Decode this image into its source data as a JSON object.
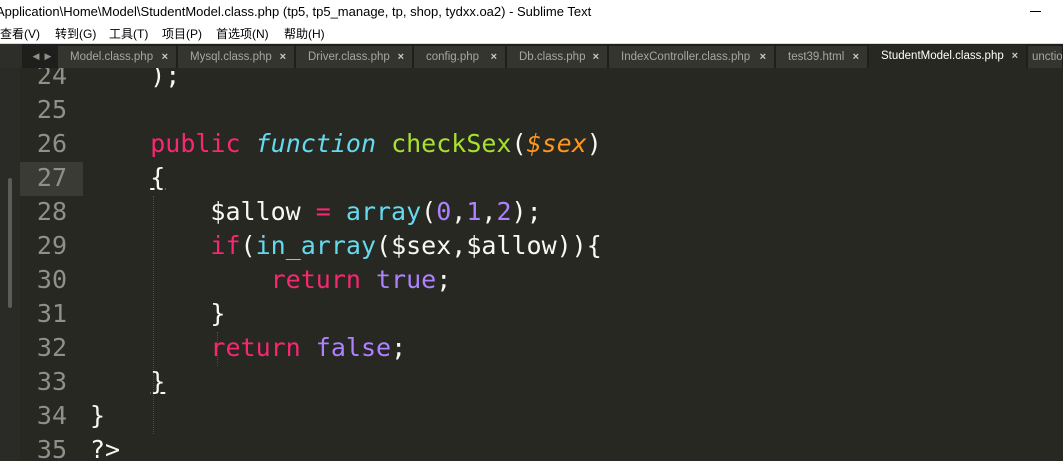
{
  "window": {
    "title": "Application\\Home\\Model\\StudentModel.class.php (tp5, tp5_manage, tp, shop, tydxx.oa2) - Sublime Text"
  },
  "menu": [
    "查看(V)",
    "转到(G)",
    "工具(T)",
    "项目(P)",
    "首选项(N)",
    "帮助(H)"
  ],
  "tabs": [
    {
      "label": "Model.class.php",
      "close": "×"
    },
    {
      "label": "Mysql.class.php",
      "close": "×"
    },
    {
      "label": "Driver.class.php",
      "close": "×"
    },
    {
      "label": "config.php",
      "close": "×"
    },
    {
      "label": "Db.class.php",
      "close": "×"
    },
    {
      "label": "IndexController.class.php",
      "close": "×"
    },
    {
      "label": "test39.html",
      "close": "×"
    },
    {
      "label": "StudentModel.class.php",
      "close": "×",
      "active": true
    },
    {
      "label": "unctio",
      "close": ""
    }
  ],
  "tab_arrows": {
    "left": "◀",
    "right": "▶"
  },
  "editor": {
    "current_line": "27",
    "lines": [
      {
        "num": "24",
        "parts": [
          {
            "t": "    );",
            "c": ""
          }
        ]
      },
      {
        "num": "25",
        "parts": []
      },
      {
        "num": "26",
        "parts": [
          {
            "t": "    ",
            "c": ""
          },
          {
            "t": "public",
            "c": "kw"
          },
          {
            "t": " ",
            "c": ""
          },
          {
            "t": "function",
            "c": "st"
          },
          {
            "t": " ",
            "c": ""
          },
          {
            "t": "checkSex",
            "c": "fn"
          },
          {
            "t": "(",
            "c": ""
          },
          {
            "t": "$sex",
            "c": "par"
          },
          {
            "t": ")",
            "c": ""
          }
        ]
      },
      {
        "num": "27",
        "parts": [
          {
            "t": "    ",
            "c": ""
          },
          {
            "t": "{",
            "c": "brace-under"
          }
        ]
      },
      {
        "num": "28",
        "parts": [
          {
            "t": "        $allow ",
            "c": ""
          },
          {
            "t": "=",
            "c": "kw"
          },
          {
            "t": " ",
            "c": ""
          },
          {
            "t": "array",
            "c": "bi"
          },
          {
            "t": "(",
            "c": ""
          },
          {
            "t": "0",
            "c": "num"
          },
          {
            "t": ",",
            "c": ""
          },
          {
            "t": "1",
            "c": "num"
          },
          {
            "t": ",",
            "c": ""
          },
          {
            "t": "2",
            "c": "num"
          },
          {
            "t": ");",
            "c": ""
          }
        ]
      },
      {
        "num": "29",
        "parts": [
          {
            "t": "        ",
            "c": ""
          },
          {
            "t": "if",
            "c": "kw"
          },
          {
            "t": "(",
            "c": ""
          },
          {
            "t": "in_array",
            "c": "bi"
          },
          {
            "t": "($sex,$allow)){",
            "c": ""
          }
        ]
      },
      {
        "num": "30",
        "parts": [
          {
            "t": "            ",
            "c": ""
          },
          {
            "t": "return",
            "c": "kw"
          },
          {
            "t": " ",
            "c": ""
          },
          {
            "t": "true",
            "c": "num"
          },
          {
            "t": ";",
            "c": ""
          }
        ]
      },
      {
        "num": "31",
        "parts": [
          {
            "t": "        }",
            "c": ""
          }
        ]
      },
      {
        "num": "32",
        "parts": [
          {
            "t": "        ",
            "c": ""
          },
          {
            "t": "return",
            "c": "kw"
          },
          {
            "t": " ",
            "c": ""
          },
          {
            "t": "false",
            "c": "num"
          },
          {
            "t": ";",
            "c": ""
          }
        ]
      },
      {
        "num": "33",
        "parts": [
          {
            "t": "    ",
            "c": ""
          },
          {
            "t": "}",
            "c": "brace-under"
          }
        ]
      },
      {
        "num": "34",
        "parts": [
          {
            "t": "}",
            "c": ""
          }
        ]
      },
      {
        "num": "35",
        "parts": [
          {
            "t": "?>",
            "c": ""
          }
        ]
      }
    ]
  },
  "colors": {
    "background": "#272822",
    "keyword": "#f92672",
    "storage": "#66d9ef",
    "function_name": "#a6e22e",
    "parameter": "#fd971f",
    "constant": "#ae81ff",
    "text": "#f8f8f2",
    "gutter": "#8f908a"
  }
}
